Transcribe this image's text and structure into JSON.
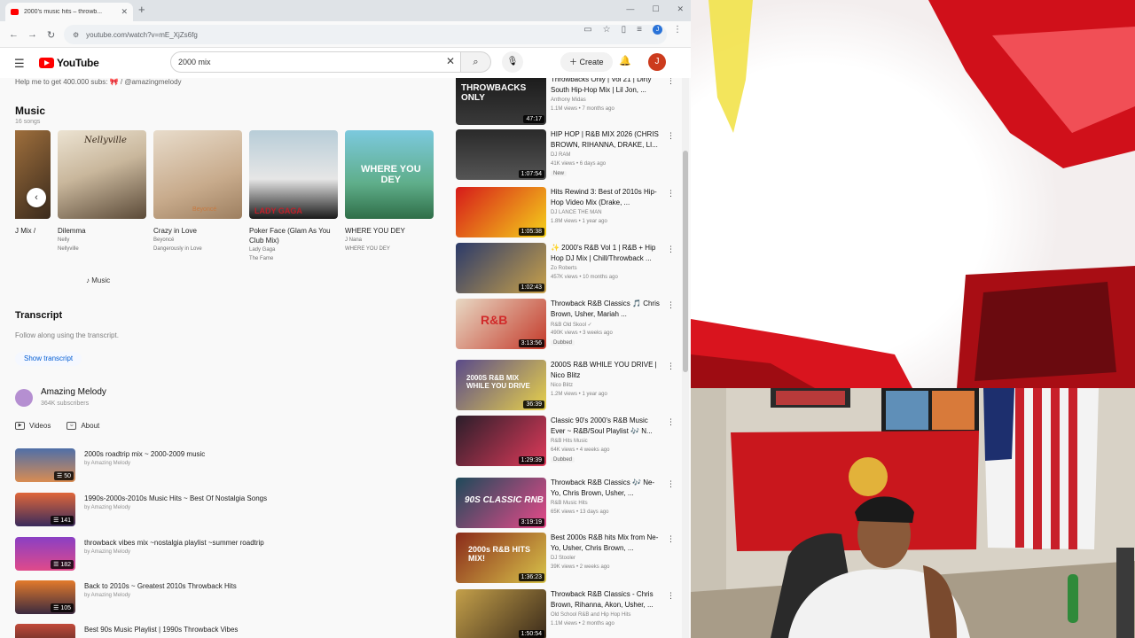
{
  "browser": {
    "tab_title": "2000's music hits – throwb...",
    "url": "youtube.com/watch?v=mE_XjZs6fg",
    "new_tab_glyph": "+",
    "profile_initial": "J"
  },
  "youtube": {
    "logo_text": "YouTube",
    "search_query": "2000 mix",
    "create_label": "Create",
    "avatar_initial": "J"
  },
  "description": {
    "line": "Help me to get 400.000 subs: 🎀 / @amazingmelody",
    "music_heading": "Music",
    "music_count": "16 songs",
    "albums": [
      {
        "title": "J Mix /",
        "artist": "",
        "album": "",
        "color1": "#c98c4a",
        "color2": "#3a2a1c"
      },
      {
        "title": "Dilemma",
        "artist": "Nelly",
        "album": "Nellyville",
        "color1": "#e5dccc",
        "color2": "#7d6a52"
      },
      {
        "title": "Crazy in Love",
        "artist": "Beyoncé",
        "album": "Dangerously in Love",
        "color1": "#d9c7b4",
        "color2": "#b2977a"
      },
      {
        "title": "Poker Face (Glam As You Club Mix)",
        "artist": "Lady Gaga",
        "album": "The Fame",
        "color1": "#9fb6c4",
        "color2": "#2a2a2a"
      },
      {
        "title": "WHERE YOU DEY",
        "artist": "J Nana",
        "album": "WHERE YOU DEY",
        "color1": "#6cc0d8",
        "color2": "#2b7a52"
      }
    ],
    "music_link": "Music",
    "transcript_heading": "Transcript",
    "transcript_sub": "Follow along using the transcript.",
    "show_transcript": "Show transcript",
    "channel_name": "Amazing Melody",
    "channel_subs": "364K subscribers",
    "tab_videos": "Videos",
    "tab_about": "About",
    "playlists": [
      {
        "title": "2000s roadtrip mix ~ 2000-2009 music",
        "by": "by Amazing Melody",
        "count": "50",
        "color1": "#4f6fa8",
        "color2": "#d98c52"
      },
      {
        "title": "1990s-2000s-2010s Music Hits ~ Best Of Nostalgia Songs",
        "by": "by Amazing Melody",
        "count": "141",
        "color1": "#e0673a",
        "color2": "#3a2b5c"
      },
      {
        "title": "throwback vibes mix ~nostalgia playlist ~summer roadtrip",
        "by": "by Amazing Melody",
        "count": "182",
        "color1": "#8a3fc4",
        "color2": "#e04a8a"
      },
      {
        "title": "Back to 2010s ~ Greatest 2010s Throwback Hits",
        "by": "by Amazing Melody",
        "count": "105",
        "color1": "#e37a2b",
        "color2": "#3b2a3f"
      },
      {
        "title": "Best 90s Music Playlist | 1990s Throwback Vibes",
        "by": "",
        "count": "",
        "color1": "#c24a3a",
        "color2": "#2a1e1e"
      }
    ]
  },
  "recommendations": [
    {
      "title": "Throwbacks Only | Vol 21 | Dirty South Hip-Hop Mix | Lil Jon, ...",
      "channel": "Anthony Midas",
      "meta": "1.1M views • 7 months ago",
      "duration": "47:17",
      "badge": "",
      "color1": "#1a1a1a",
      "color2": "#d8b12a"
    },
    {
      "title": "HIP HOP | R&B MIX 2026 (CHRIS BROWN, RIHANNA, DRAKE, LI...",
      "channel": "DJ RAM",
      "meta": "41K views • 6 days ago",
      "duration": "1:07:54",
      "badge": "New",
      "color1": "#2a2a2a",
      "color2": "#6a6a6a"
    },
    {
      "title": "Hits Rewind 3: Best of 2010s Hip-Hop Video Mix (Drake, ...",
      "channel": "DJ LANCE THE MAN",
      "meta": "1.8M views • 1 year ago",
      "duration": "1:05:38",
      "badge": "",
      "color1": "#d61a1a",
      "color2": "#f5d21a"
    },
    {
      "title": "✨ 2000's R&B Vol 1 | R&B + Hip Hop DJ Mix | Chill/Throwback ...",
      "channel": "Zo Roberts",
      "meta": "457K views • 10 months ago",
      "duration": "1:02:43",
      "badge": "",
      "color1": "#2b3a6a",
      "color2": "#c9a14a"
    },
    {
      "title": "Throwback R&B Classics 🎵 Chris Brown, Usher, Mariah ...",
      "channel": "R&B Old Skool ✓",
      "meta": "490K views • 3 weeks ago",
      "duration": "3:13:56",
      "badge": "Dubbed",
      "color1": "#e8d9c4",
      "color2": "#c43a2a"
    },
    {
      "title": "2000S R&B WHILE YOU DRIVE | Nico Blitz",
      "channel": "Nico Blitz",
      "meta": "1.2M views • 1 year ago",
      "duration": "36:39",
      "badge": "",
      "color1": "#5a4a8a",
      "color2": "#e8d24a"
    },
    {
      "title": "Classic 90's 2000's R&B Music Ever ~ R&B/Soul Playlist 🎶 N...",
      "channel": "R&B Hits Music",
      "meta": "64K views • 4 weeks ago",
      "duration": "1:29:39",
      "badge": "Dubbed",
      "color1": "#2a1e2a",
      "color2": "#e03a5a"
    },
    {
      "title": "Throwback R&B Classics 🎶 Ne-Yo, Chris Brown, Usher, ...",
      "channel": "R&B Music Hits",
      "meta": "65K views • 13 days ago",
      "duration": "3:19:19",
      "badge": "",
      "color1": "#1e4a5a",
      "color2": "#e84a8a"
    },
    {
      "title": "Best 2000s R&B hits Mix from Ne-Yo, Usher, Chris Brown, ...",
      "channel": "DJ Stooler",
      "meta": "39K views • 2 weeks ago",
      "duration": "1:36:23",
      "badge": "",
      "color1": "#8a2a1a",
      "color2": "#d8c44a"
    },
    {
      "title": "Throwback R&B Classics - Chris Brown, Rihanna, Akon, Usher, ...",
      "channel": "Old School R&B and Hip Hop Hits",
      "meta": "1.1M views • 2 months ago",
      "duration": "1:50:54",
      "badge": "",
      "color1": "#c4a04a",
      "color2": "#3a2a1a"
    }
  ]
}
